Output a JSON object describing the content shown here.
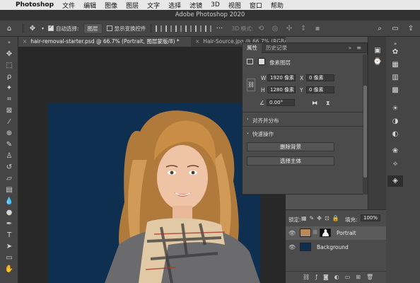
{
  "menubar": {
    "app": "Photoshop",
    "items": [
      "文件",
      "编辑",
      "图像",
      "图层",
      "文字",
      "选择",
      "滤镜",
      "3D",
      "视图",
      "窗口",
      "帮助"
    ]
  },
  "window": {
    "title": "Adobe Photoshop 2020"
  },
  "options": {
    "auto_select_label": "自动选择:",
    "auto_select_target": "图层",
    "show_transform_label": "显示变换控件",
    "mode_3d_label": "3D 模式:"
  },
  "tabs": [
    {
      "label": "hair-removal-starter.psd @ 66.7% (Portrait, 图层蒙版/8) *",
      "active": true
    },
    {
      "label": "Hair-Source.jpg @ 66.7% (RGB/8)",
      "active": false
    }
  ],
  "properties": {
    "tab_properties": "属性",
    "tab_history": "历史记录",
    "layer_type": "像素图层",
    "w_label": "W",
    "w_value": "1920 像素",
    "h_label": "H",
    "h_value": "1280 像素",
    "x_label": "X",
    "x_value": "0 像素",
    "y_label": "Y",
    "y_value": "0 像素",
    "angle_value": "0.00°",
    "section_align": "对齐并分布",
    "section_quick": "快速操作",
    "btn_remove_bg": "删除背景",
    "btn_select_subject": "选择主体"
  },
  "layers": {
    "lock_label": "锁定:",
    "fill_label": "填充:",
    "fill_value": "100%",
    "items": [
      {
        "name": "Portrait",
        "selected": true
      },
      {
        "name": "Background",
        "selected": false
      }
    ]
  },
  "colors": {
    "background_layer": "#0e2f4f",
    "panel": "#4b4b4b",
    "canvas": "#282828"
  }
}
